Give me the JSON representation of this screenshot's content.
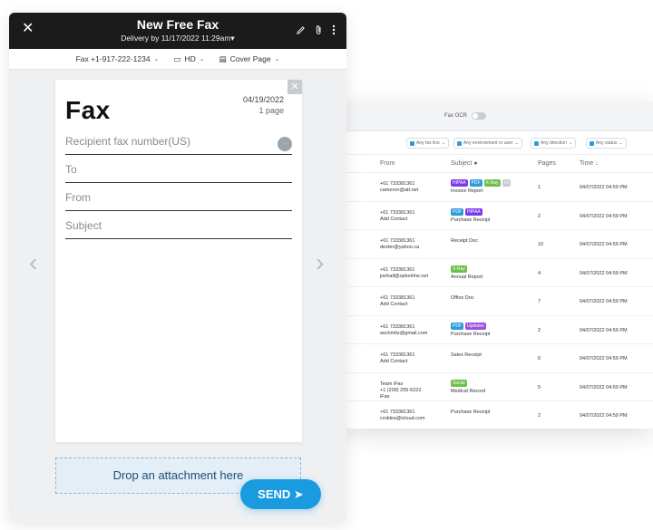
{
  "fax_window": {
    "title": "New Free Fax",
    "delivery": "Delivery by 11/17/2022 11:29am",
    "toolbar": {
      "fax_number": "Fax ‪+1-917-222-1234",
      "quality": "HD",
      "cover_page": "Cover Page"
    },
    "sheet": {
      "heading": "Fax",
      "date": "04/19/2022",
      "pages": "1 page",
      "recipient_placeholder": "Recipient fax number(US)",
      "to_placeholder": "To",
      "from_placeholder": "From",
      "subject_placeholder": "Subject"
    },
    "drop_text": "Drop an attachment here",
    "send_label": "SEND"
  },
  "history_window": {
    "fax_ocr_label": "Fax OCR",
    "filters": [
      {
        "label": "Any fax line",
        "color": "#2d9cdb"
      },
      {
        "label": "Any environment or user",
        "color": "#2d9cdb"
      },
      {
        "label": "Any direction",
        "color": "#2d9cdb"
      },
      {
        "label": "Any status",
        "color": "#2d9cdb"
      }
    ],
    "columns": {
      "from": "From",
      "subject": "Subject",
      "pages": "Pages",
      "time": "Time"
    },
    "rows": [
      {
        "from_line1": "+61 733381361",
        "from_line2": "cameron@att.net",
        "from_line3": "",
        "tags": [
          {
            "t": "HIPAA",
            "c": "#7c3aed"
          },
          {
            "t": "PDF",
            "c": "#2d9cdb"
          },
          {
            "t": "X-Ray",
            "c": "#6cc04a"
          },
          {
            "t": "+1",
            "c": "#c7ccd2"
          }
        ],
        "subject": "Invoice Report",
        "pages": "1",
        "time": "04/07/2022 04:59 PM"
      },
      {
        "from_line1": "+61 733381361",
        "from_line2": "Add Contact",
        "from_line3": "",
        "tags": [
          {
            "t": "PDF",
            "c": "#2d9cdb"
          },
          {
            "t": "HIPAA",
            "c": "#7c3aed"
          }
        ],
        "subject": "Purchase Receipt",
        "pages": "2",
        "time": "04/07/2022 04:59 PM"
      },
      {
        "from_line1": "+61 733381361",
        "from_line2": "dexter@yahoo.ca",
        "from_line3": "",
        "tags": [],
        "subject": "Receipt Doc",
        "pages": "10",
        "time": "04/07/2022 04:59 PM"
      },
      {
        "from_line1": "+61 733381361",
        "from_line2": "joehall@optonline.net",
        "from_line3": "",
        "tags": [
          {
            "t": "X-Ray",
            "c": "#6cc04a"
          }
        ],
        "subject": "Annual Report",
        "pages": "4",
        "time": "04/07/2022 04:59 PM"
      },
      {
        "from_line1": "+61 733381361",
        "from_line2": "Add Contact",
        "from_line3": "",
        "tags": [],
        "subject": "Office Doc",
        "pages": "7",
        "time": "04/07/2022 04:59 PM"
      },
      {
        "from_line1": "+61 733381361",
        "from_line2": "aschmitz@gmail.com",
        "from_line3": "",
        "tags": [
          {
            "t": "PDF",
            "c": "#2d9cdb"
          },
          {
            "t": "Updates",
            "c": "#9b51e0"
          }
        ],
        "subject": "Purchase Receipt",
        "pages": "2",
        "time": "04/07/2022 04:59 PM"
      },
      {
        "from_line1": "+61 733381361",
        "from_line2": "Add Contact",
        "from_line3": "",
        "tags": [],
        "subject": "Sales Receipt",
        "pages": "6",
        "time": "04/07/2022 04:59 PM"
      },
      {
        "from_line1": "Team iFax",
        "from_line2": "+1 (209) 255-5222",
        "from_line3": "iFax",
        "tags": [
          {
            "t": "Social",
            "c": "#6cc04a"
          }
        ],
        "subject": "Medical Record",
        "pages": "5",
        "time": "04/07/2022 04:59 PM"
      },
      {
        "from_line1": "+61 733381361",
        "from_line2": "crobles@icloud.com",
        "from_line3": "",
        "tags": [],
        "subject": "Purchase Receipt",
        "pages": "2",
        "time": "04/07/2022 04:59 PM"
      }
    ]
  }
}
